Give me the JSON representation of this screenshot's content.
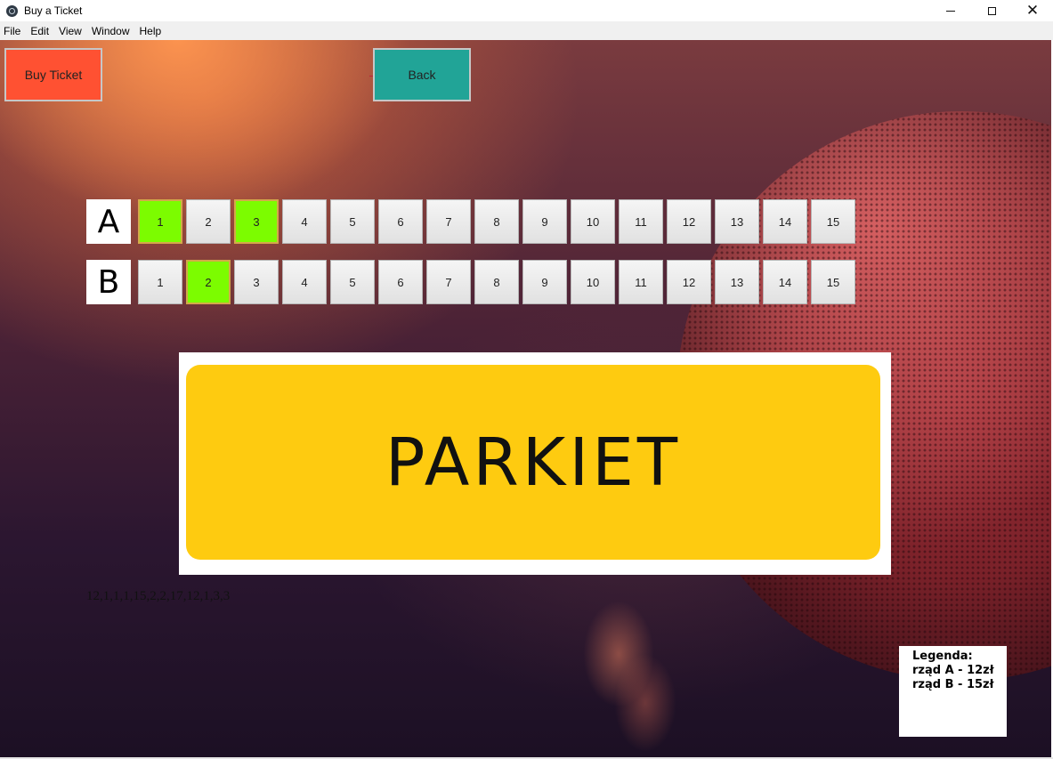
{
  "window": {
    "title": "Buy a Ticket",
    "controls": {
      "minimize": "minimize-icon",
      "maximize": "maximize-icon",
      "close": "close-icon"
    }
  },
  "menu": [
    "File",
    "Edit",
    "View",
    "Window",
    "Help"
  ],
  "toolbar": {
    "buy_label": "Buy Ticket",
    "back_label": "Back"
  },
  "rows": [
    {
      "label": "A",
      "seats": [
        "1",
        "2",
        "3",
        "4",
        "5",
        "6",
        "7",
        "8",
        "9",
        "10",
        "11",
        "12",
        "13",
        "14",
        "15"
      ],
      "selected": [
        "1",
        "3"
      ]
    },
    {
      "label": "B",
      "seats": [
        "1",
        "2",
        "3",
        "4",
        "5",
        "6",
        "7",
        "8",
        "9",
        "10",
        "11",
        "12",
        "13",
        "14",
        "15"
      ],
      "selected": [
        "2"
      ]
    }
  ],
  "floor_label": "PARKIET",
  "picked_text": "12,1,1,1,15,2,2,17,12,1,3,3",
  "legend": {
    "title": "Legenda:",
    "line_a": "rząd A - 12zł",
    "line_b": "rząd B - 15zł"
  },
  "colors": {
    "buy_button": "#ff5132",
    "back_button": "#21a497",
    "seat_selected": "#7cfc00",
    "seat_default": "#e8e8e8",
    "floor": "#fecb10"
  }
}
